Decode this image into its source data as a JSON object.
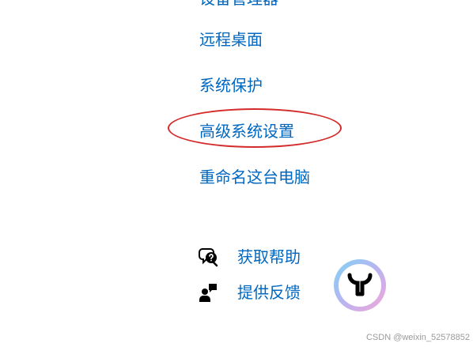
{
  "links": {
    "partial_top": "设备管理器",
    "remote_desktop": "远程桌面",
    "system_protection": "系统保护",
    "advanced_settings": "高级系统设置",
    "rename_pc": "重命名这台电脑"
  },
  "help": {
    "get_help": "获取帮助",
    "give_feedback": "提供反馈"
  },
  "colors": {
    "link": "#0067c0",
    "highlight": "#d42a2a"
  },
  "watermark": "CSDN @weixin_52578852"
}
